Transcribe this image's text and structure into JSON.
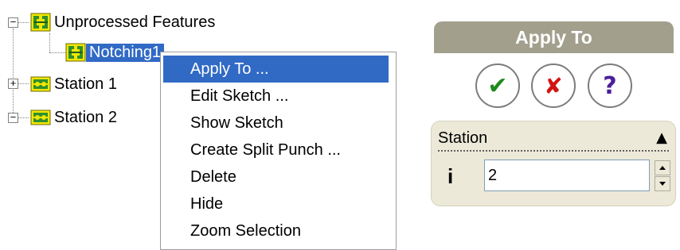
{
  "tree": {
    "unprocessed": {
      "label": "Unprocessed Features",
      "expander": "−"
    },
    "notching": {
      "label": "Notching1"
    },
    "station1": {
      "label": "Station 1",
      "expander": "+"
    },
    "station2": {
      "label": "Station 2",
      "expander": "−"
    }
  },
  "context_menu": {
    "items": [
      "Apply To ...",
      "Edit Sketch ...",
      "Show Sketch",
      "Create Split Punch ...",
      "Delete",
      "Hide",
      "Zoom Selection"
    ],
    "highlighted_index": 0
  },
  "property_manager": {
    "title": "Apply To",
    "buttons": {
      "ok": "✔",
      "cancel": "✘",
      "help": "?"
    },
    "group": {
      "title": "Station",
      "collapse_icon": "▲",
      "field_icon": "i",
      "value": "2"
    }
  },
  "colors": {
    "selection": "#316ac5",
    "title_bar": "#a2a08d",
    "group_bg": "#ece9d8",
    "ok_green": "#1f8a1f",
    "cancel_red": "#d21414",
    "help_purple": "#4b1e9a",
    "icon_yellow": "#f2e600",
    "icon_green": "#2f8f2f"
  }
}
